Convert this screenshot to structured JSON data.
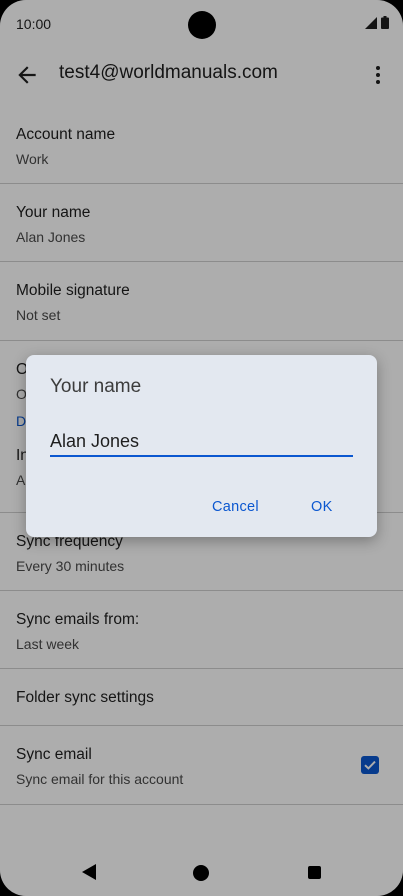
{
  "status_bar": {
    "time": "10:00"
  },
  "toolbar": {
    "title": "test4@worldmanuals.com"
  },
  "settings": {
    "account_name": {
      "title": "Account name",
      "value": "Work"
    },
    "your_name": {
      "title": "Your name",
      "value": "Alan Jones"
    },
    "mobile_signature": {
      "title": "Mobile signature",
      "value": "Not set"
    },
    "row_4": {
      "title": "O",
      "value": "O"
    },
    "section_header": "D",
    "row_5": {
      "title": "In",
      "value": "A"
    },
    "sync_frequency": {
      "title": "Sync frequency",
      "value": "Every 30 minutes"
    },
    "sync_emails_from": {
      "title": "Sync emails from:",
      "value": "Last week"
    },
    "folder_sync": {
      "title": "Folder sync settings"
    },
    "sync_email": {
      "title": "Sync email",
      "value": "Sync email for this account",
      "checked": true
    }
  },
  "dialog": {
    "title": "Your name",
    "input_value": "Alan Jones",
    "cancel_label": "Cancel",
    "ok_label": "OK"
  },
  "colors": {
    "accent": "#0b57d0",
    "dialog_bg": "#e3e8f0"
  }
}
